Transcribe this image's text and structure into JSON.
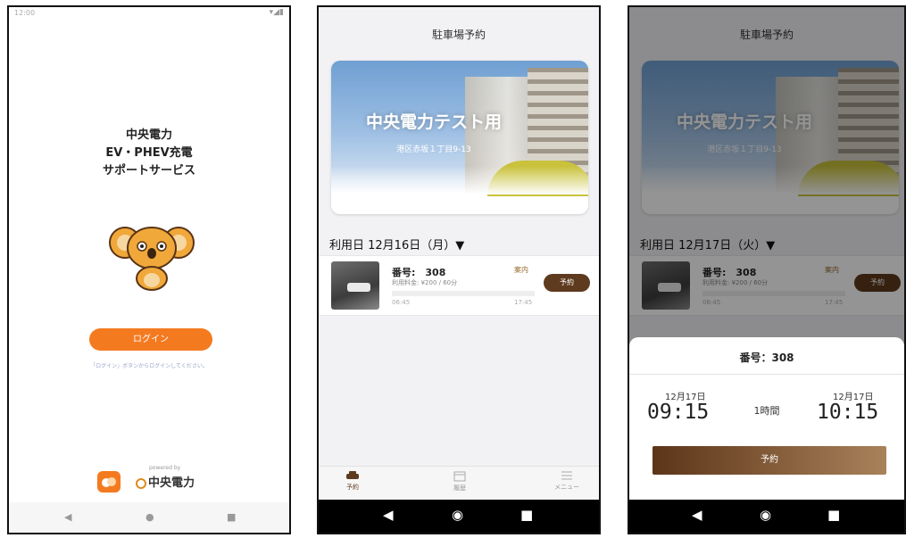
{
  "login_screen": {
    "status_time": "12:00",
    "title_lines": [
      "中央電力",
      "EV・PHEV充電",
      "サポートサービス"
    ],
    "login_button": "ログイン",
    "login_hint": "「ログイン」ボタンからログインしてください。",
    "powered_by": "powered by",
    "company_logo_text": "中央電力"
  },
  "booking_screen": {
    "header_title": "駐車場予約",
    "banner_title": "中央電力テスト用",
    "banner_address": "港区赤坂１丁目9-13",
    "date_label": "利用日 12月16日（月）▼",
    "spot": {
      "number": "番号:　308",
      "price": "利用料金: ¥200 / 60分",
      "guide": "案内",
      "start": "06:45",
      "end": "17:45",
      "reserve_button": "予約"
    },
    "tabs": [
      {
        "label": "予約",
        "icon": "car-icon"
      },
      {
        "label": "履歴",
        "icon": "calendar-icon"
      },
      {
        "label": "メニュー",
        "icon": "menu-icon"
      }
    ]
  },
  "modal_screen": {
    "header_title": "駐車場予約",
    "banner_title": "中央電力テスト用",
    "banner_address": "港区赤坂１丁目9-13",
    "date_label": "利用日 12月17日（火）▼",
    "spot": {
      "number": "番号:　308",
      "price": "利用料金: ¥200 / 60分",
      "guide": "案内",
      "start": "06:45",
      "end": "17:45",
      "reserve_button": "予約"
    },
    "sheet": {
      "number": "番号：308",
      "start_date": "12月17日",
      "start_time": "09:15",
      "duration": "1時間",
      "end_date": "12月17日",
      "end_time": "10:15",
      "confirm_button": "予約"
    }
  },
  "colors": {
    "orange": "#f47a20",
    "brown": "#5e3a1e"
  }
}
